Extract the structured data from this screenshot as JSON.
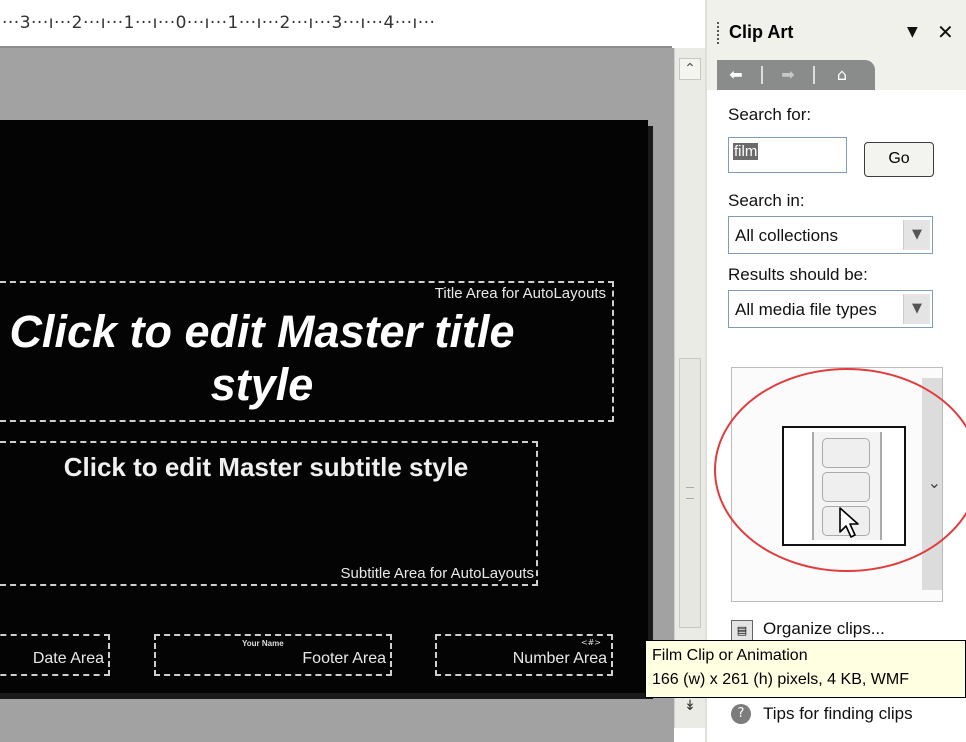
{
  "ruler": {
    "scale_text": "···3···ı···2···ı···1···ı···0···ı···1···ı···2···ı···3···ı···4···ı···"
  },
  "slide": {
    "title_label": "Title Area for AutoLayouts",
    "title_text": "Click to edit Master title style",
    "subtitle_text": "Click to edit Master subtitle style",
    "subtitle_label": "Subtitle Area for AutoLayouts",
    "date_label": "Date Area",
    "footer_small": "Your Name",
    "footer_label": "Footer Area",
    "number_small": "<#>",
    "number_label": "Number Area"
  },
  "taskpane": {
    "title": "Clip Art",
    "nav": {
      "back_icon": "back-arrow-icon",
      "forward_icon": "forward-arrow-icon",
      "home_icon": "home-icon"
    },
    "search_label": "Search for:",
    "search_value": "film",
    "go_label": "Go",
    "search_in_label": "Search in:",
    "search_in_value": "All collections",
    "results_label": "Results should be:",
    "results_value": "All media file types",
    "organize_label": "Organize clips...",
    "tips_label": "Tips for finding clips"
  },
  "tooltip": {
    "line1": "Film Clip or Animation",
    "line2": "166 (w) x 261 (h) pixels, 4 KB, WMF"
  },
  "colors": {
    "highlight_ring": "#e23b3b",
    "slide_bg": "#040404",
    "tooltip_bg": "#ffffe1"
  }
}
